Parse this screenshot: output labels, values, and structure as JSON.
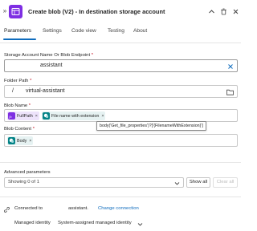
{
  "header": {
    "title": "Create blob (V2) - In destination storage account",
    "collapse_glyph": "»",
    "icons": [
      "chevron-double-right-icon",
      "blob-action-icon",
      "chevron-up-icon",
      "delete-icon",
      "close-icon"
    ]
  },
  "tabs": [
    {
      "label": "Parameters",
      "active": true
    },
    {
      "label": "Settings",
      "active": false
    },
    {
      "label": "Code view",
      "active": false
    },
    {
      "label": "Testing",
      "active": false
    },
    {
      "label": "About",
      "active": false
    }
  ],
  "fields": {
    "storage_account": {
      "label": "Storage Account Name Or Blob Endpoint",
      "required_mark": "*",
      "value": "assistant"
    },
    "folder_path": {
      "label": "Folder Path",
      "required_mark": "*",
      "prefix": "/",
      "value": "virtual-assistant"
    },
    "blob_name": {
      "label": "Blob Name",
      "required_mark": "*",
      "tokens": [
        {
          "label": "FullPath",
          "close": "×",
          "icon": "fx-icon",
          "color": "#7e2ee3"
        },
        {
          "label": "File name with extension",
          "close": "×",
          "icon": "sharepoint-icon",
          "color": "#038387"
        }
      ],
      "tooltip": "body('Get_file_properties')?['{FilenameWithExtension}']"
    },
    "blob_content": {
      "label": "Blob Content",
      "required_mark": "*",
      "tokens": [
        {
          "label": "Body",
          "close": "×",
          "icon": "sharepoint-icon",
          "color": "#038387"
        }
      ]
    }
  },
  "advanced": {
    "label": "Advanced parameters",
    "select_value": "Showing 0 of 1",
    "show_all": "Show all",
    "clear_all": "Clear all"
  },
  "connection": {
    "connected_label": "Connected to",
    "connection_name": "assistant.",
    "change_link": "Change connection",
    "identity_label": "Managed identity",
    "identity_value": "System-assigned managed identity"
  },
  "colors": {
    "accent": "#0f6cbd",
    "app_icon": "#7e2ee3",
    "required": "#c50f1f",
    "sharepoint": "#038387"
  }
}
